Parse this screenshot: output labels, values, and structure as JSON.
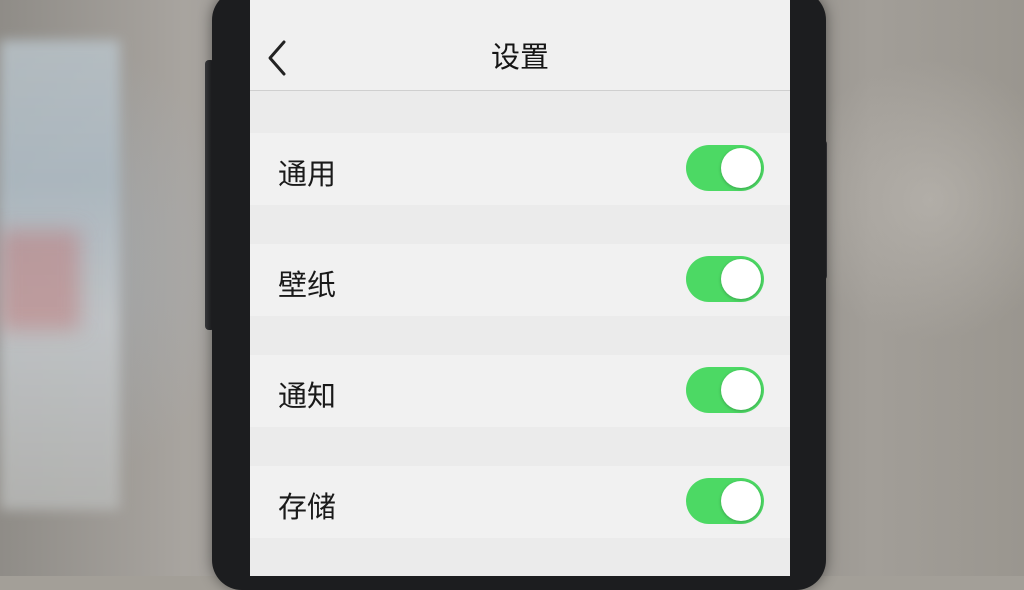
{
  "nav": {
    "back_icon": "chevron-left-icon",
    "title": "设置"
  },
  "settings": [
    {
      "label": "通用",
      "enabled": true
    },
    {
      "label": "壁纸",
      "enabled": true
    },
    {
      "label": "通知",
      "enabled": true
    },
    {
      "label": "存储",
      "enabled": true
    }
  ],
  "colors": {
    "toggle_on": "#4cd964",
    "screen_bg": "#ebebeb",
    "row_bg": "#f1f1f1"
  }
}
